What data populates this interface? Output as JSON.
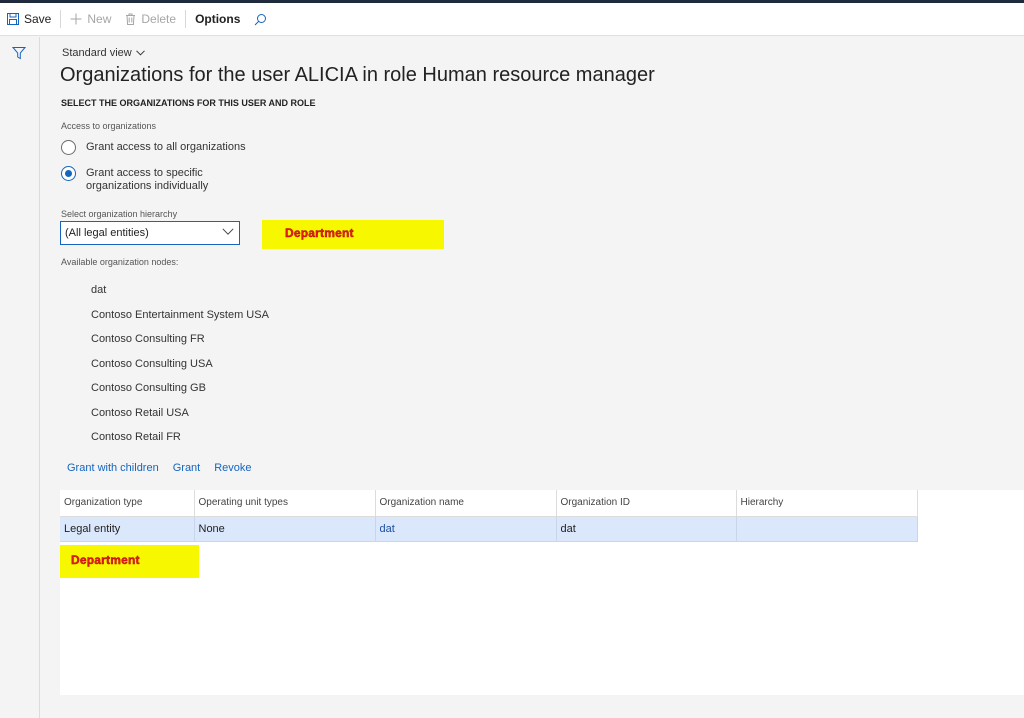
{
  "toolbar": {
    "save": "Save",
    "new": "New",
    "delete": "Delete",
    "options": "Options",
    "icons": [
      "save-icon",
      "plus-icon",
      "trash-icon",
      "search-icon"
    ]
  },
  "view_selector": "Standard view",
  "page_title": "Organizations for the user ALICIA in role Human resource manager",
  "section_title": "SELECT THE ORGANIZATIONS FOR THIS USER AND ROLE",
  "access": {
    "label": "Access to organizations",
    "options": [
      {
        "label": "Grant access to all organizations",
        "selected": false
      },
      {
        "label": "Grant access to specific organizations individually",
        "selected": true
      }
    ]
  },
  "hierarchy": {
    "label": "Select organization hierarchy",
    "value": "(All legal entities)"
  },
  "annotations": [
    "Department",
    "Department"
  ],
  "nodes": {
    "label": "Available organization nodes:",
    "items": [
      "dat",
      "Contoso Entertainment System USA",
      "Contoso Consulting FR",
      "Contoso Consulting USA",
      "Contoso Consulting GB",
      "Contoso Retail USA",
      "Contoso Retail FR"
    ]
  },
  "actions": [
    "Grant with children",
    "Grant",
    "Revoke"
  ],
  "grid": {
    "columns": [
      "Organization type",
      "Operating unit types",
      "Organization name",
      "Organization ID",
      "Hierarchy"
    ],
    "rows": [
      [
        "Legal entity",
        "None",
        "dat",
        "dat",
        ""
      ]
    ]
  },
  "colors": {
    "accent": "#1565c0",
    "highlight": "#f7f700",
    "annotation_text": "#e02020",
    "selected_row": "#dbe7fb"
  }
}
